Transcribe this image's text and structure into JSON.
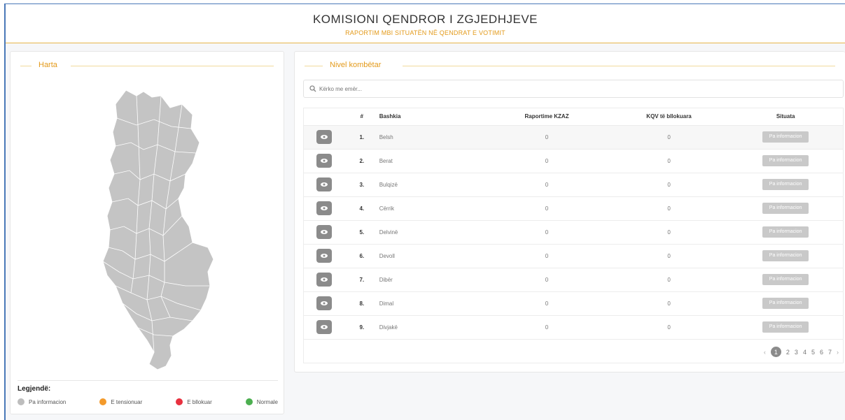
{
  "header": {
    "title": "KOMISIONI QENDROR I ZGJEDHJEVE",
    "subtitle": "RAPORTIM MBI SITUATËN NË QENDRAT E VOTIMIT"
  },
  "map_panel": {
    "title": "Harta",
    "legend_title": "Legjendë:",
    "legend": [
      {
        "label": "Pa informacion",
        "color": "#bdbdbd"
      },
      {
        "label": "E tensionuar",
        "color": "#f39a2b"
      },
      {
        "label": "E bllokuar",
        "color": "#e8313f"
      },
      {
        "label": "Normale",
        "color": "#4caf50"
      }
    ]
  },
  "national_panel": {
    "title": "Nivel kombëtar",
    "search_placeholder": "Kërko me emër...",
    "columns": {
      "index": "#",
      "name": "Bashkia",
      "reports": "Raportime KZAZ",
      "blocked": "KQV të bllokuara",
      "status": "Situata"
    },
    "rows": [
      {
        "index": "1.",
        "name": "Belsh",
        "reports": "0",
        "blocked": "0",
        "status": "Pa informacion"
      },
      {
        "index": "2.",
        "name": "Berat",
        "reports": "0",
        "blocked": "0",
        "status": "Pa informacion"
      },
      {
        "index": "3.",
        "name": "Bulqizë",
        "reports": "0",
        "blocked": "0",
        "status": "Pa informacion"
      },
      {
        "index": "4.",
        "name": "Cërrik",
        "reports": "0",
        "blocked": "0",
        "status": "Pa informacion"
      },
      {
        "index": "5.",
        "name": "Delvinë",
        "reports": "0",
        "blocked": "0",
        "status": "Pa informacion"
      },
      {
        "index": "6.",
        "name": "Devoll",
        "reports": "0",
        "blocked": "0",
        "status": "Pa informacion"
      },
      {
        "index": "7.",
        "name": "Dibër",
        "reports": "0",
        "blocked": "0",
        "status": "Pa informacion"
      },
      {
        "index": "8.",
        "name": "Dimal",
        "reports": "0",
        "blocked": "0",
        "status": "Pa informacion"
      },
      {
        "index": "9.",
        "name": "Divjakë",
        "reports": "0",
        "blocked": "0",
        "status": "Pa informacion"
      }
    ],
    "pagination": {
      "prev": "‹",
      "pages": [
        "1",
        "2",
        "3",
        "4",
        "5",
        "6",
        "7"
      ],
      "current": "1",
      "next": "›"
    }
  },
  "colors": {
    "accent": "#e39a1a",
    "status_gray": "#c9c9c9",
    "button_gray": "#8b8b8b",
    "map_fill": "#c4c4c4",
    "frame_border": "#4a78b8"
  }
}
